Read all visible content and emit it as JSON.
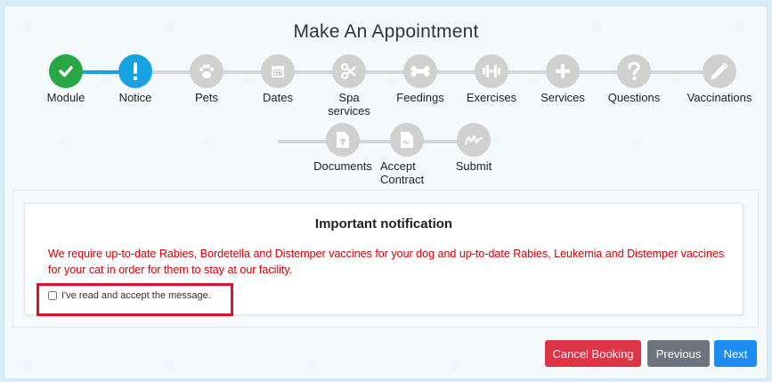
{
  "header": {
    "title": "Make An Appointment"
  },
  "steps": [
    {
      "label": "Module",
      "icon": "check-icon",
      "state": "done"
    },
    {
      "label": "Notice",
      "icon": "exclamation-icon",
      "state": "active"
    },
    {
      "label": "Pets",
      "icon": "paw-icon",
      "state": "pending"
    },
    {
      "label": "Dates",
      "icon": "calendar-icon",
      "state": "pending"
    },
    {
      "label": "Spa services",
      "icon": "scissors-icon",
      "state": "pending"
    },
    {
      "label": "Feedings",
      "icon": "bone-icon",
      "state": "pending"
    },
    {
      "label": "Exercises",
      "icon": "dumbbell-icon",
      "state": "pending"
    },
    {
      "label": "Services",
      "icon": "plus-icon",
      "state": "pending"
    },
    {
      "label": "Questions",
      "icon": "question-icon",
      "state": "pending"
    },
    {
      "label": "Vaccinations",
      "icon": "syringe-icon",
      "state": "pending"
    },
    {
      "label": "Documents",
      "icon": "document-upload-icon",
      "state": "pending"
    },
    {
      "label": "Accept Contract",
      "icon": "contract-icon",
      "state": "pending"
    },
    {
      "label": "Submit",
      "icon": "signature-icon",
      "state": "pending"
    }
  ],
  "notice": {
    "title": "Important notification",
    "text": "We require up-to-date Rabies, Bordetella and Distemper vaccines for your dog and up-to-date Rabies, Leukemia and Distemper vaccines for your cat in order for them to stay at our facility.",
    "checkbox_label": "I've read and accept the message.",
    "checked": false
  },
  "buttons": {
    "cancel": "Cancel Booking",
    "previous": "Previous",
    "next": "Next"
  },
  "colors": {
    "done": "#28a745",
    "active": "#17a2e3",
    "pending": "#d0d0d0",
    "notice_text": "#d60000",
    "cancel": "#dc3545",
    "previous": "#6c757d",
    "next": "#1f8cf2"
  }
}
